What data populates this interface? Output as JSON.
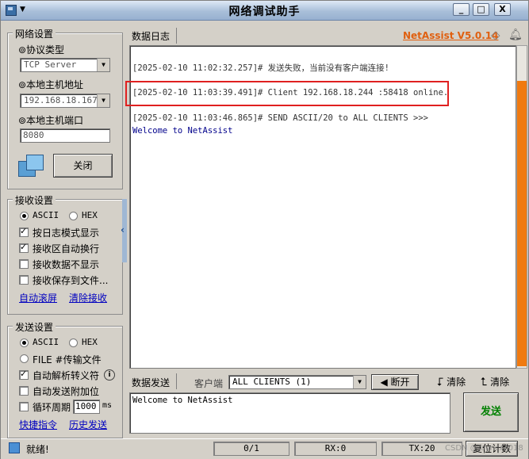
{
  "window": {
    "title": "网络调试助手",
    "min": "_",
    "max": "□",
    "close": "X"
  },
  "network": {
    "group_title": "网络设置",
    "protocol_label": "⊚协议类型",
    "protocol_value": "TCP Server",
    "host_label": "⊚本地主机地址",
    "host_value": "192.168.18.167",
    "port_label": "⊚本地主机端口",
    "port_value": "8080",
    "close_button": "关闭"
  },
  "receive": {
    "group_title": "接收设置",
    "ascii": "ASCII",
    "hex": "HEX",
    "opt1": "按日志模式显示",
    "opt2": "接收区自动换行",
    "opt3": "接收数据不显示",
    "opt4": "接收保存到文件...",
    "link1": "自动滚屏",
    "link2": "清除接收"
  },
  "send": {
    "group_title": "发送设置",
    "ascii": "ASCII",
    "file": "FILE #传输文件",
    "hex": "HEX",
    "opt1": "自动解析转义符",
    "opt2": "自动发送附加位",
    "opt3": "循环周期",
    "period": "1000",
    "unit": "ms",
    "link1": "快捷指令",
    "link2": "历史发送"
  },
  "log": {
    "tab": "数据日志",
    "brand": "NetAssist V5.0.14",
    "lines": [
      "[2025-02-10 11:02:32.257]# 发送失败，当前没有客户端连接!",
      "[2025-02-10 11:03:39.491]# Client 192.168.18.244 :58418 online.",
      "[2025-02-10 11:03:46.865]# SEND ASCII/20 to ALL CLIENTS >>>",
      "Welcome to NetAssist"
    ]
  },
  "sendbar": {
    "tab": "数据发送",
    "client_label": "客户端",
    "client_value": "ALL CLIENTS (1)",
    "disconnect": "断开",
    "clear1": "清除",
    "clear2": "清除",
    "text": "Welcome to NetAssist",
    "send_button": "发送"
  },
  "status": {
    "text": "就绪!",
    "count": "0/1",
    "rx": "RX:0",
    "tx": "TX:20",
    "reset": "复位计数",
    "watermark": "CSDN @Joyner2018"
  },
  "colors": {
    "highlight_box": "#e02020",
    "brand": "#e06010",
    "scroll_thumb": "#f07a10",
    "send_text": "#008000"
  }
}
